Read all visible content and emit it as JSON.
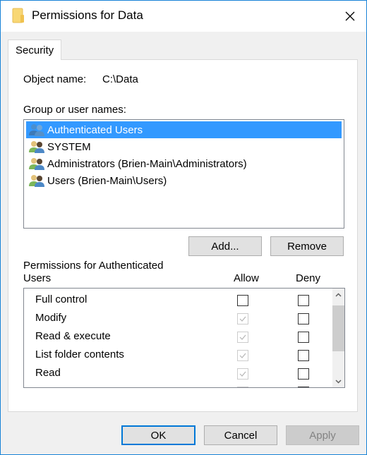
{
  "window": {
    "title": "Permissions for Data",
    "title_icon": "folder-icon",
    "close_icon": "close-icon"
  },
  "tabs": [
    {
      "label": "Security",
      "active": true
    }
  ],
  "object_name": {
    "label": "Object name:",
    "value": "C:\\Data"
  },
  "groups": {
    "label": "Group or user names:",
    "items": [
      {
        "name": "Authenticated Users",
        "icon": "users-group-icon",
        "selected": true
      },
      {
        "name": "SYSTEM",
        "icon": "users-group-icon",
        "selected": false
      },
      {
        "name": "Administrators (Brien-Main\\Administrators)",
        "icon": "users-group-icon",
        "selected": false
      },
      {
        "name": "Users (Brien-Main\\Users)",
        "icon": "users-group-icon",
        "selected": false
      }
    ],
    "add_label": "Add...",
    "remove_label": "Remove"
  },
  "permissions": {
    "label_line1": "Permissions for Authenticated",
    "label_line2": "Users",
    "allow_header": "Allow",
    "deny_header": "Deny",
    "rows": [
      {
        "name": "Full control",
        "allow": false,
        "allow_disabled": false,
        "deny": false
      },
      {
        "name": "Modify",
        "allow": true,
        "allow_disabled": true,
        "deny": false
      },
      {
        "name": "Read & execute",
        "allow": true,
        "allow_disabled": true,
        "deny": false
      },
      {
        "name": "List folder contents",
        "allow": true,
        "allow_disabled": true,
        "deny": false
      },
      {
        "name": "Read",
        "allow": true,
        "allow_disabled": true,
        "deny": false
      },
      {
        "name": "",
        "allow": true,
        "allow_disabled": true,
        "deny": false
      }
    ]
  },
  "footer": {
    "ok_label": "OK",
    "cancel_label": "Cancel",
    "apply_label": "Apply",
    "apply_enabled": false
  },
  "colors": {
    "selection": "#3399ff",
    "accent_border": "#1883d7",
    "default_button_border": "#0078d7"
  }
}
